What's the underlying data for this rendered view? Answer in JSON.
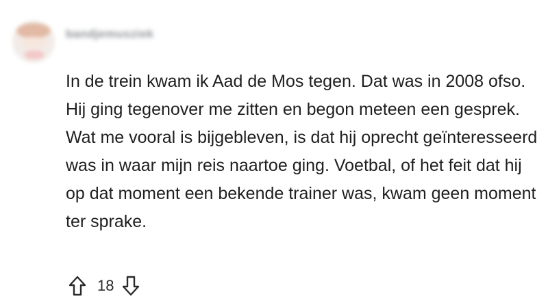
{
  "comment": {
    "username": "bandjemusziek",
    "body": "In de trein kwam ik Aad de Mos tegen. Dat was in 2008 ofso. Hij ging tegenover me zitten en begon meteen een gesprek. Wat me vooral is bijgebleven, is dat hij oprecht geïnteresseerd was in waar mijn reis naartoe ging. Voetbal, of het feit dat hij op dat moment een bekende trainer was, kwam geen moment ter sprake.",
    "score": "18"
  },
  "icons": {
    "upvote": "arrow-up-outline-icon",
    "downvote": "arrow-down-outline-icon"
  },
  "colors": {
    "text": "#1f1f1f",
    "icon": "#2a2a2a",
    "background": "#ffffff"
  }
}
